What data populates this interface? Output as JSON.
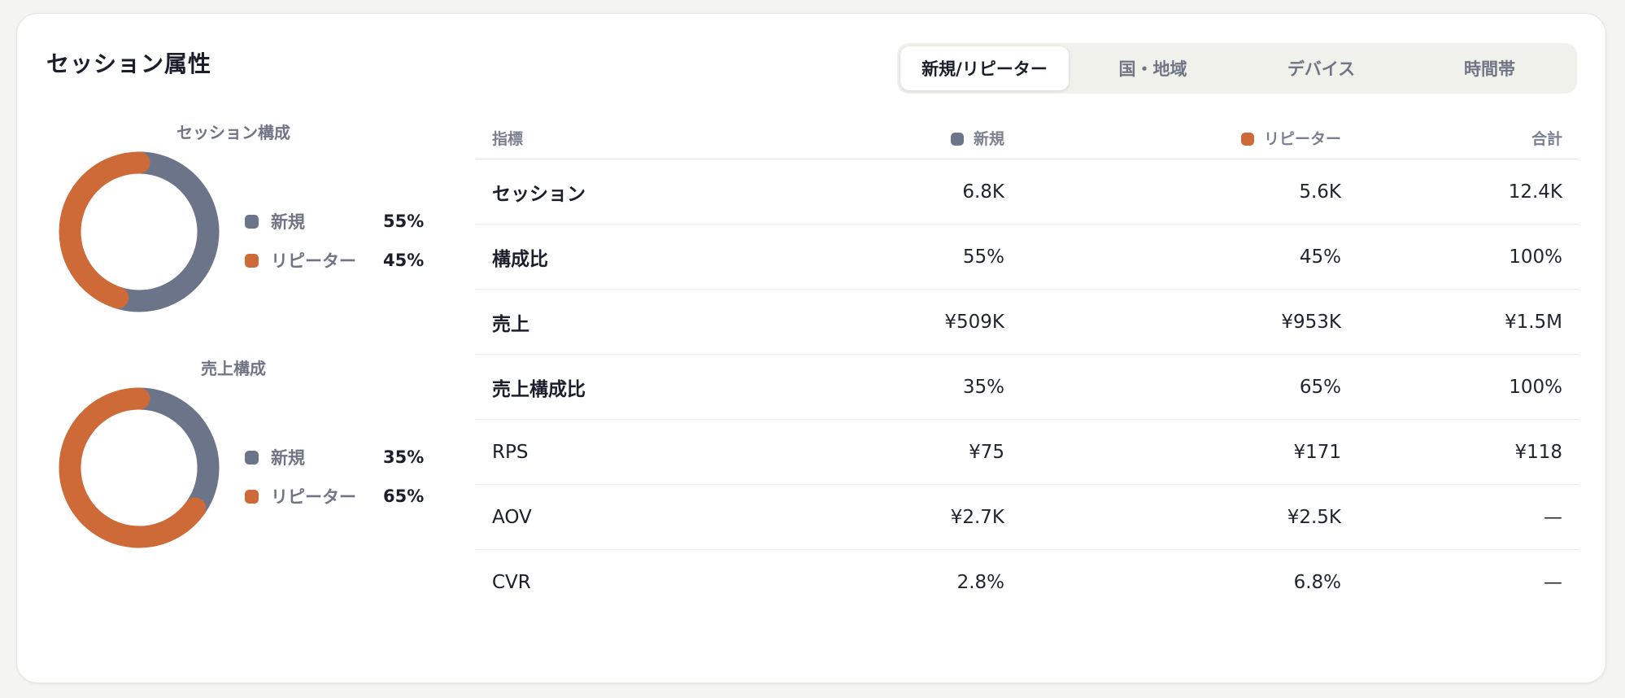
{
  "title": "セッション属性",
  "tabs": [
    {
      "label": "新規/リピーター",
      "active": true
    },
    {
      "label": "国・地域",
      "active": false
    },
    {
      "label": "デバイス",
      "active": false
    },
    {
      "label": "時間帯",
      "active": false
    }
  ],
  "colors": {
    "new": "#6b7489",
    "repeater": "#cd6a38"
  },
  "chart_data": [
    {
      "type": "pie",
      "title": "セッション構成",
      "series": [
        {
          "name": "新規",
          "value": 55,
          "label": "55%"
        },
        {
          "name": "リピーター",
          "value": 45,
          "label": "45%"
        }
      ]
    },
    {
      "type": "pie",
      "title": "売上構成",
      "series": [
        {
          "name": "新規",
          "value": 35,
          "label": "35%"
        },
        {
          "name": "リピーター",
          "value": 65,
          "label": "65%"
        }
      ]
    }
  ],
  "table": {
    "headers": {
      "metric": "指標",
      "new": "新規",
      "repeater": "リピーター",
      "total": "合計"
    },
    "rows": [
      {
        "metric": "セッション",
        "new": "6.8K",
        "repeater": "5.6K",
        "total": "12.4K"
      },
      {
        "metric": "構成比",
        "new": "55%",
        "repeater": "45%",
        "total": "100%"
      },
      {
        "metric": "売上",
        "new": "¥509K",
        "repeater": "¥953K",
        "total": "¥1.5M"
      },
      {
        "metric": "売上構成比",
        "new": "35%",
        "repeater": "65%",
        "total": "100%"
      },
      {
        "metric": "RPS",
        "new": "¥75",
        "repeater": "¥171",
        "total": "¥118"
      },
      {
        "metric": "AOV",
        "new": "¥2.7K",
        "repeater": "¥2.5K",
        "total": "—"
      },
      {
        "metric": "CVR",
        "new": "2.8%",
        "repeater": "6.8%",
        "total": "—"
      }
    ]
  }
}
